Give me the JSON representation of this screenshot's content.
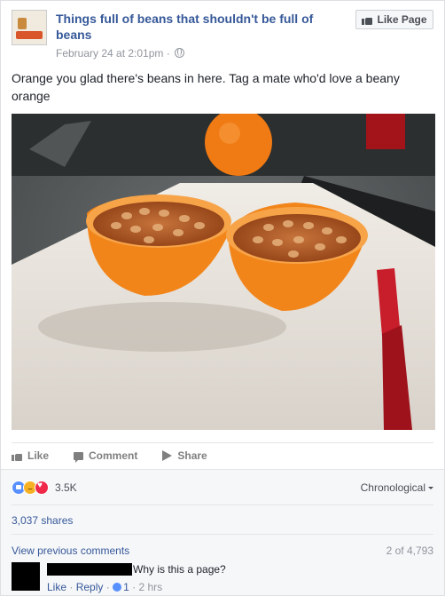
{
  "post": {
    "page_name": "Things full of beans that shouldn't be full of beans",
    "timestamp": "February 24 at 2:01pm",
    "separator": "·",
    "like_page_label": "Like Page",
    "text": "Orange you glad there's beans in here. Tag a mate who'd love a beany orange"
  },
  "actions": {
    "like": "Like",
    "comment": "Comment",
    "share": "Share"
  },
  "stats": {
    "reaction_count": "3.5K",
    "reaction_types": [
      "like-icon",
      "sad-icon",
      "love-icon"
    ],
    "sort_label": "Chronological",
    "shares": "3,037 shares"
  },
  "comments": {
    "view_previous": "View previous comments",
    "pager": "2 of 4,793",
    "items": [
      {
        "text": "Why is this a page?",
        "like": "Like",
        "reply": "Reply",
        "reactions": "1",
        "time": "2 hrs"
      }
    ]
  },
  "colors": {
    "link": "#365899",
    "muted": "#90949c",
    "like_blue": "#5890ff",
    "love_red": "#f0284a",
    "sad_yellow": "#f7b125"
  }
}
